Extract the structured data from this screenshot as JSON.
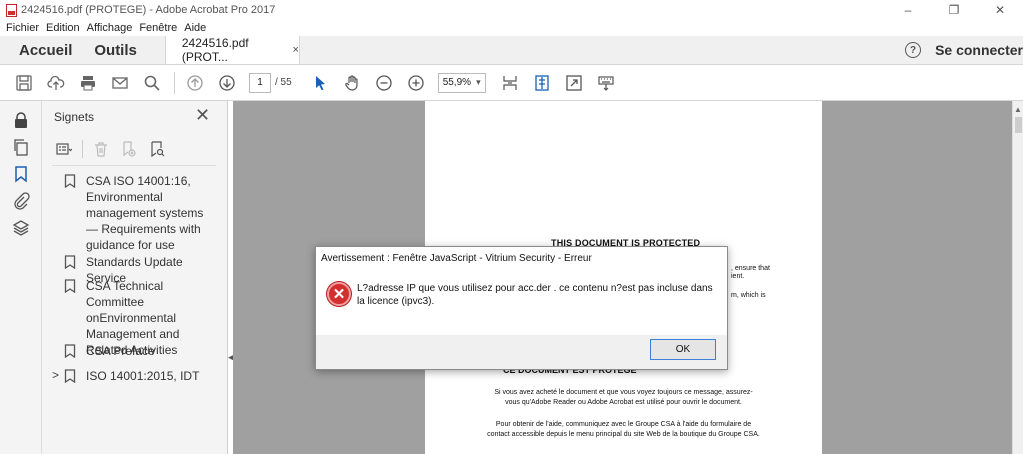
{
  "window": {
    "title": "2424516.pdf (PROTEGE) - Adobe Acrobat Pro 2017",
    "minimize": "–",
    "maximize": "❐",
    "close": "✕"
  },
  "menu": [
    "Fichier",
    "Edition",
    "Affichage",
    "Fenêtre",
    "Aide"
  ],
  "tabs": {
    "home": "Accueil",
    "tools": "Outils",
    "document": "2424516.pdf (PROT...",
    "document_close": "×",
    "help": "?",
    "sign_in": "Se connecter"
  },
  "toolbar": {
    "current_page": "1",
    "total_pages": "/ 55",
    "zoom": "55,9%"
  },
  "bookmarks": {
    "title": "Signets",
    "close": "✕",
    "items": [
      {
        "label": "CSA ISO 14001:16, Environmental management systems — Requirements with guidance for use"
      },
      {
        "label": "Standards Update Service"
      },
      {
        "label": "CSA Technical Committee onEnvironmental Management and Related Activities"
      },
      {
        "label": "CSA Preface"
      },
      {
        "label": "ISO 14001:2015, IDT",
        "expander": ">"
      }
    ]
  },
  "page": {
    "title_en": "THIS DOCUMENT IS PROTECTED",
    "right_line1": ", ensure that",
    "right_line2": "ient.",
    "right_line3": "m, which is",
    "title_fr": "CE DOCUMENT EST PROTÉGÉ",
    "fr_line1": "Si vous avez acheté le document et que vous voyez toujours ce message, assurez-",
    "fr_line2": "vous qu'Adobe Reader ou Adobe Acrobat est utilisé pour ouvrir le document.",
    "fr_line3": "Pour obtenir de l'aide, communiquez avec le Groupe CSA à l'aide du formulaire de",
    "fr_line4": "contact accessible depuis le menu principal du site Web de la boutique du Groupe CSA."
  },
  "dialog": {
    "title": "Avertissement : Fenêtre JavaScript - Vitrium Security - Erreur",
    "message": "L?adresse IP que vous utilisez pour acc.der . ce contenu n?est pas incluse dans la licence (ipvc3).",
    "ok": "OK",
    "icon_glyph": "✕"
  },
  "colors": {
    "error_red": "#d32f2f",
    "doc_background": "#a0a0a0",
    "panel_bg": "#f4f4f4",
    "focus_blue": "#3c7fd6"
  }
}
